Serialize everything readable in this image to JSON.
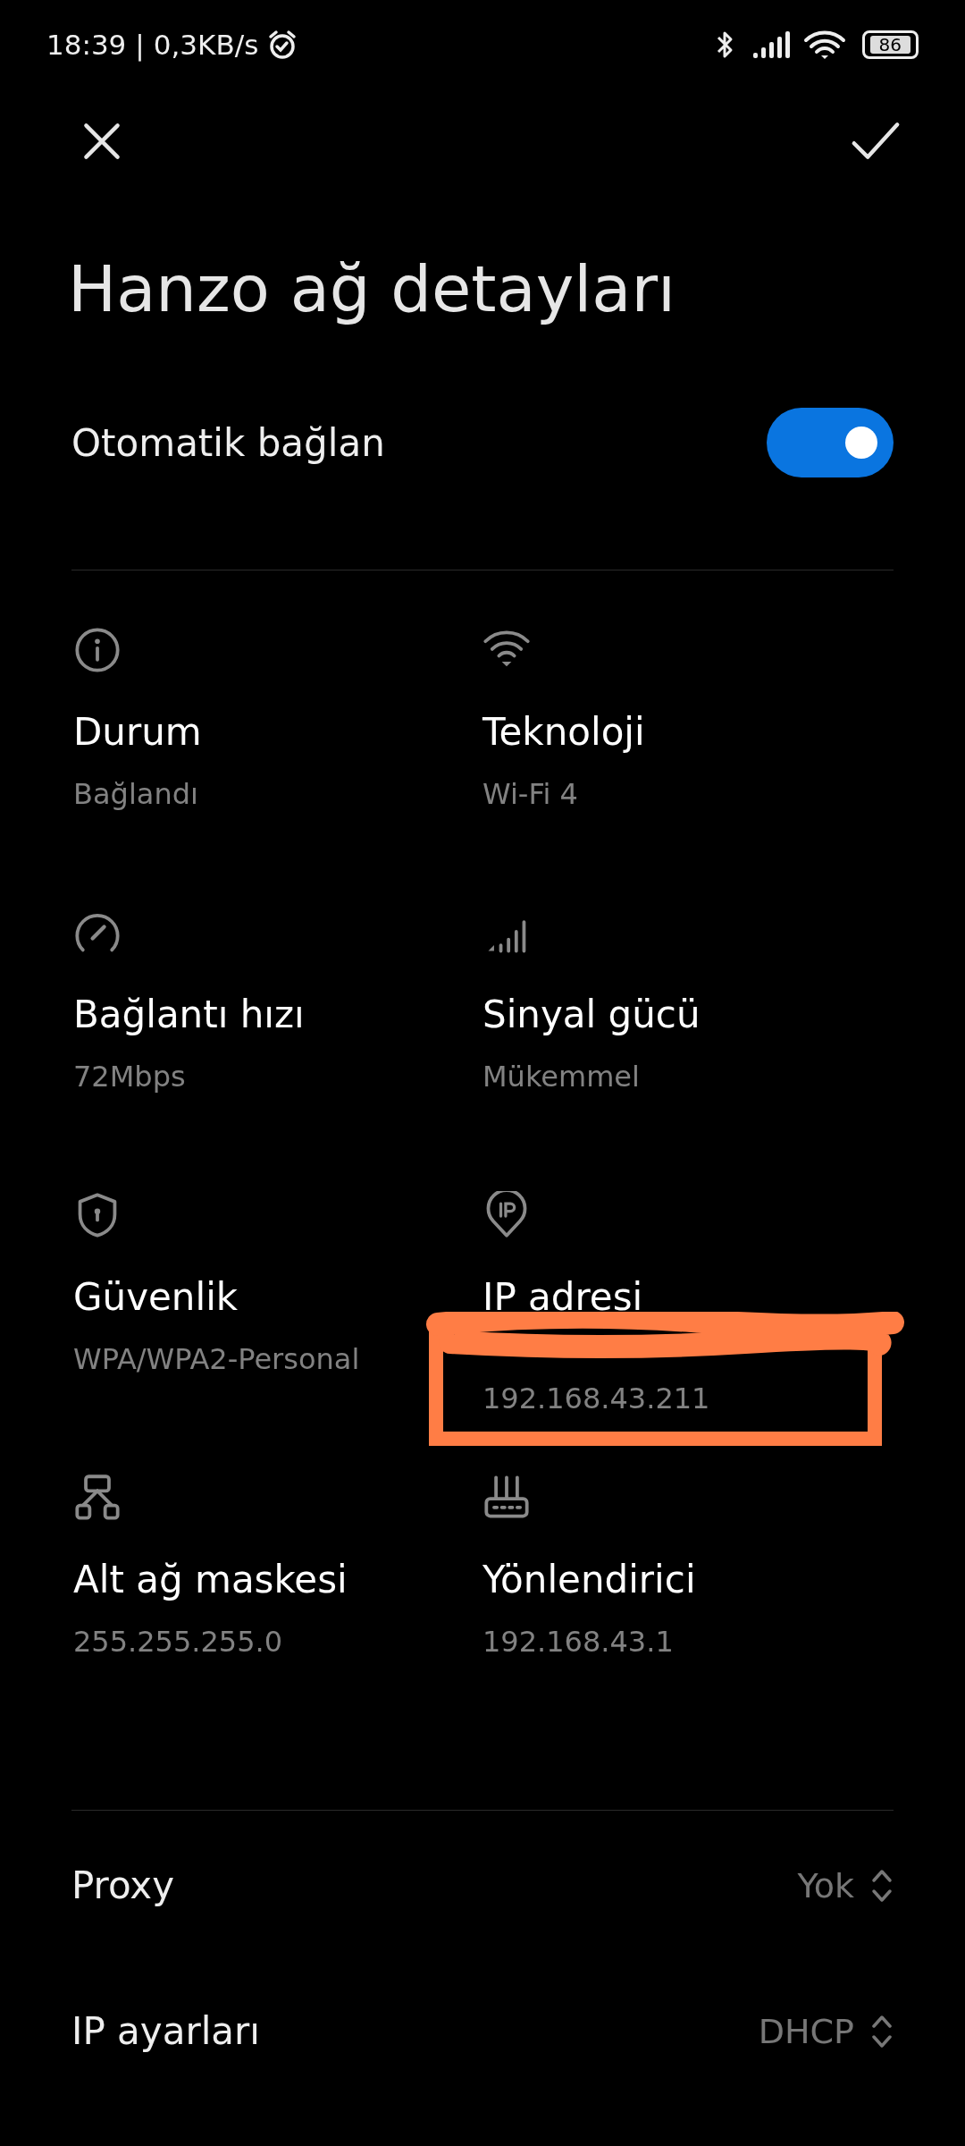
{
  "status_bar": {
    "time": "18:39",
    "separator": "|",
    "speed": "0,3KB/s",
    "battery": "86",
    "alarm": true,
    "bluetooth": true
  },
  "title": "Hanzo ağ detayları",
  "auto_connect": {
    "label": "Otomatik bağlan",
    "on": true
  },
  "details": [
    {
      "kind": "info",
      "label": "Durum",
      "value": "Bağlandı"
    },
    {
      "kind": "wifi",
      "label": "Teknoloji",
      "value": "Wi-Fi 4"
    },
    {
      "kind": "speed",
      "label": "Bağlantı hızı",
      "value": "72Mbps"
    },
    {
      "kind": "signal",
      "label": "Sinyal gücü",
      "value": "Mükemmel"
    },
    {
      "kind": "shield",
      "label": "Güvenlik",
      "value": "WPA/WPA2-Personal"
    },
    {
      "kind": "ip",
      "label": "IP adresi",
      "value": "192.168.43.211",
      "annotated": true
    },
    {
      "kind": "subnet",
      "label": "Alt ağ maskesi",
      "value": "255.255.255.0"
    },
    {
      "kind": "router",
      "label": "Yönlendirici",
      "value": "192.168.43.1"
    }
  ],
  "settings": [
    {
      "label": "Proxy",
      "value": "Yok"
    },
    {
      "label": "IP ayarları",
      "value": "DHCP"
    }
  ]
}
